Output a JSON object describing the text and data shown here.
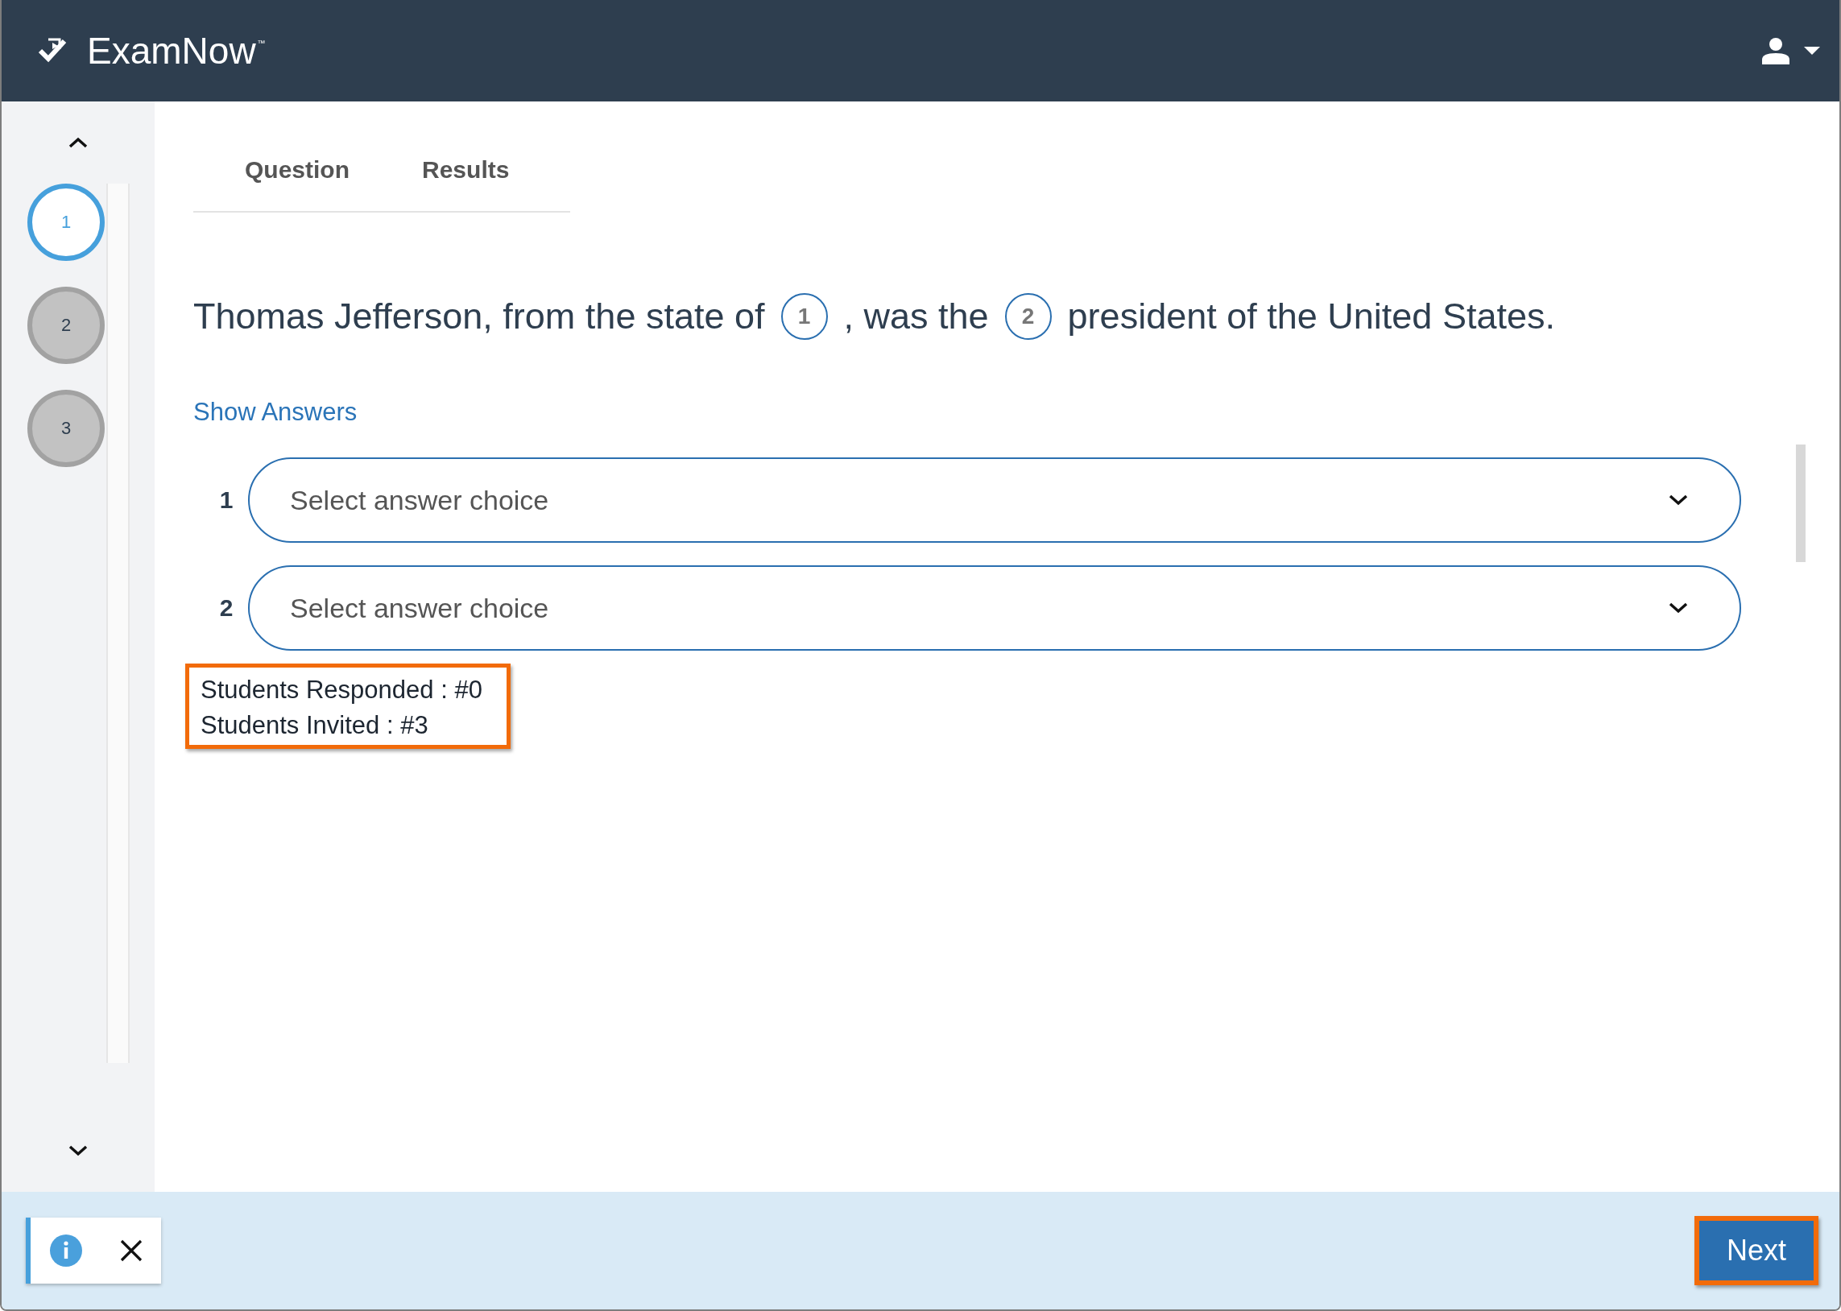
{
  "header": {
    "logo": "ExamNow",
    "trademark": "™"
  },
  "sidebar": {
    "questions": [
      {
        "number": "1",
        "selected": true
      },
      {
        "number": "2",
        "selected": false
      },
      {
        "number": "3",
        "selected": false
      }
    ]
  },
  "tabs": [
    {
      "label": "Question"
    },
    {
      "label": "Results"
    }
  ],
  "question": {
    "parts": [
      {
        "kind": "text",
        "text": "Thomas Jefferson, from the state of"
      },
      {
        "kind": "blank",
        "number": "1"
      },
      {
        "kind": "text",
        "text": ", was the"
      },
      {
        "kind": "blank",
        "number": "2"
      },
      {
        "kind": "text",
        "text": "president of the United States."
      }
    ]
  },
  "show_answers_link": "Show Answers",
  "answers": [
    {
      "number": "1",
      "placeholder": "Select answer choice"
    },
    {
      "number": "2",
      "placeholder": "Select answer choice"
    }
  ],
  "stats": [
    "Students Responded : #0",
    "Students Invited : #3"
  ],
  "footer": {
    "next_button": "Next"
  }
}
